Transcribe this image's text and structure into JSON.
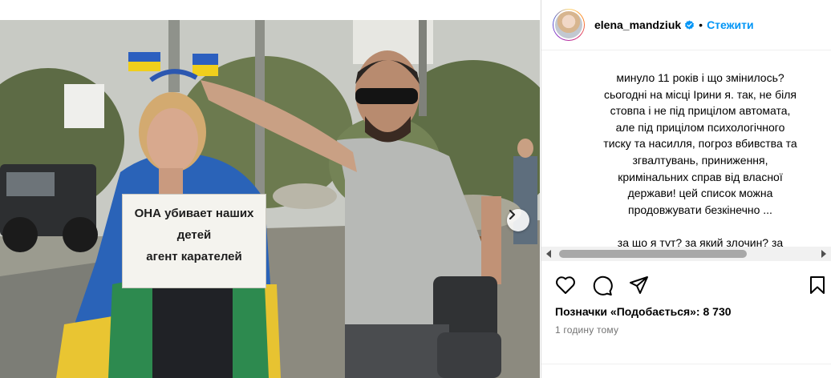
{
  "post": {
    "image": {
      "sign_lines": [
        "ОНА убивает наших",
        "детей",
        "агент карателей"
      ],
      "carousel_count": 2,
      "carousel_active": 0
    },
    "author": {
      "username": "elena_mandziuk",
      "verified": true,
      "follow_label": "Стежити",
      "separator": "•"
    },
    "caption": "минуло 11 років і що змінилось?\nсьогодні на місці Ірини я. так, не біля\nстовпа і не під прицілом автомата,\nале під прицілом психологічного\nтиску та насилля, погроз вбивства та\nзгвалтувань, приниження,\nкримінальних справ від власної\nдержави! цей список можна\nпродовжувати безкінечно ...\n\nза що я тут? за який злочин? за",
    "actions": {
      "like": "heart-icon",
      "comment": "comment-icon",
      "share": "share-icon",
      "save": "bookmark-icon"
    },
    "likes_text": "Позначки «Подобається»: 8 730",
    "timestamp": "1 годину тому"
  },
  "colors": {
    "accent": "#0095f6",
    "verified": "#0095f6",
    "muted": "#737373",
    "border": "#dbdbdb"
  }
}
